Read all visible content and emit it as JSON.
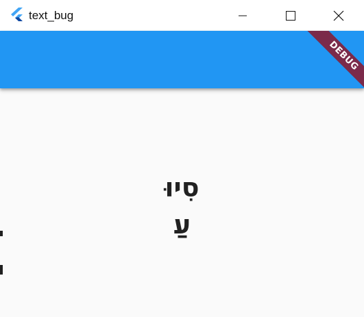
{
  "window": {
    "title": "text_bug",
    "icon": "flutter-logo-icon",
    "controls": {
      "minimize_icon": "minimize-icon",
      "maximize_icon": "maximize-icon",
      "close_icon": "close-icon"
    }
  },
  "appbar": {
    "color": "#2196f3"
  },
  "debug_banner": {
    "label": "DEBUG",
    "color": "#7b2a4a"
  },
  "content": {
    "lines": [
      "סִיוּ",
      "עַ"
    ]
  }
}
